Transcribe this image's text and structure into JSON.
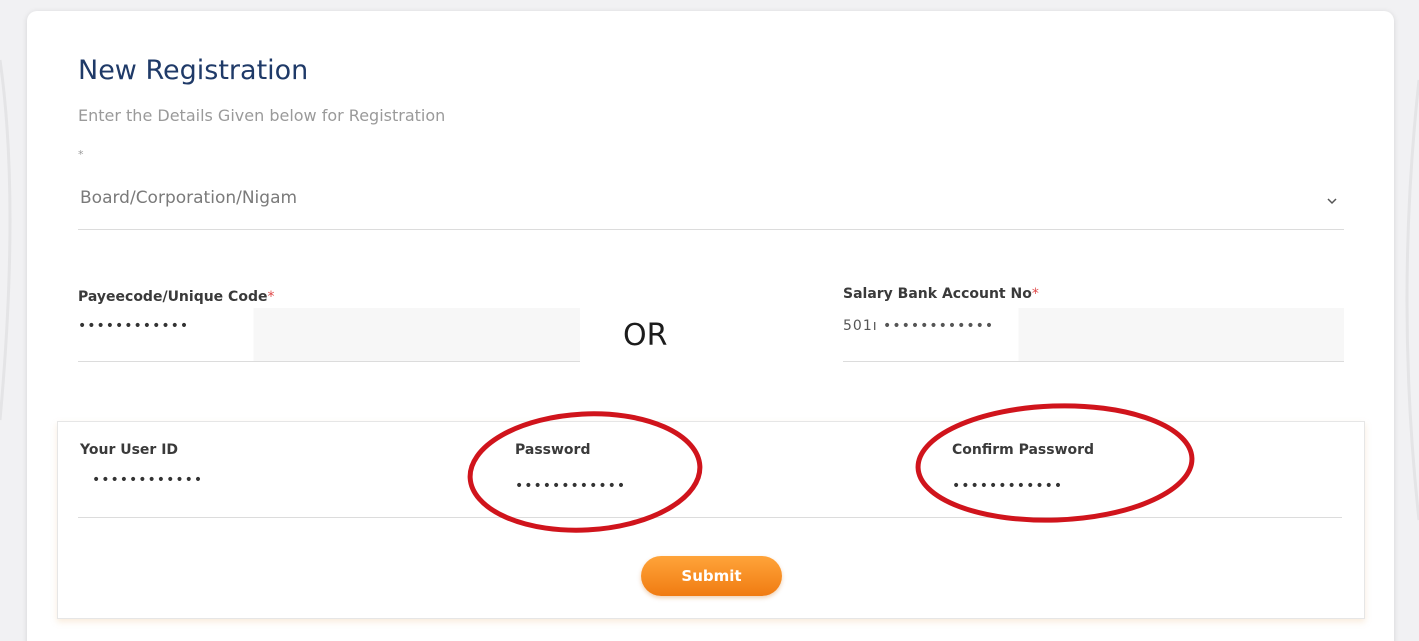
{
  "form": {
    "title": "New Registration",
    "subtitle": "Enter the Details Given below for Registration",
    "required_mark": "*",
    "organization_select": {
      "value": "Board/Corporation/Nigam"
    },
    "payee_code": {
      "label": "Payeecode/Unique Code",
      "value": "••••••••••••"
    },
    "or_separator": "OR",
    "salary_account": {
      "label": "Salary Bank Account No",
      "value": "501ı ••••••••••••"
    },
    "user_id": {
      "label": "Your User ID",
      "value": "••••••••••••"
    },
    "password": {
      "label": "Password",
      "value": "••••••••••••"
    },
    "confirm_password": {
      "label": "Confirm Password",
      "value": "••••••••••••"
    },
    "submit_label": "Submit"
  },
  "colors": {
    "title": "#1f3a68",
    "required": "#e04a4a",
    "submit_button": "#f7901e",
    "annotation_circle": "#d0141c"
  }
}
